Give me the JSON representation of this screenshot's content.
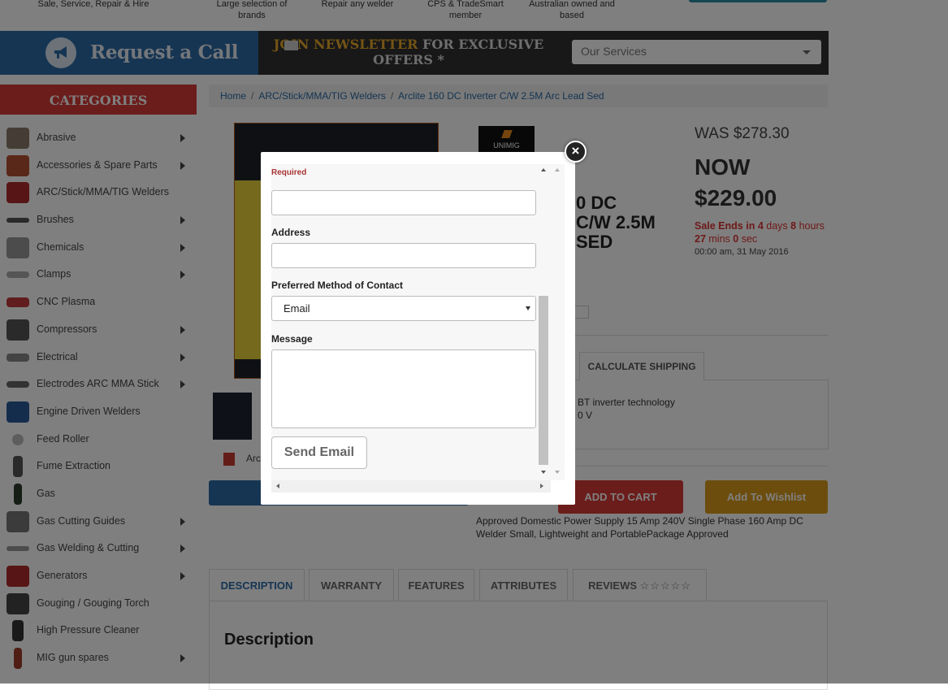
{
  "topbar": {
    "items": [
      {
        "text": "Sale, Service, Repair & Hire"
      },
      {
        "text": "Large selection of brands"
      },
      {
        "text": "Repair any welder"
      },
      {
        "text": "CPS & TradeSmart member"
      },
      {
        "text": "Australian owned and based"
      }
    ]
  },
  "header": {
    "request_call": "Request a Call",
    "newsletter_highlight": "JOIN NEWSLETTER",
    "newsletter_rest": "FOR EXCLUSIVE OFFERS *",
    "services_placeholder": "Our Services"
  },
  "sidebar": {
    "title": "CATEGORIES",
    "items": [
      {
        "label": "Abrasive",
        "has_sub": true
      },
      {
        "label": "Accessories & Spare Parts",
        "has_sub": true
      },
      {
        "label": "ARC/Stick/MMA/TIG Welders",
        "has_sub": false
      },
      {
        "label": "Brushes",
        "has_sub": true
      },
      {
        "label": "Chemicals",
        "has_sub": true
      },
      {
        "label": "Clamps",
        "has_sub": true
      },
      {
        "label": "CNC Plasma",
        "has_sub": false
      },
      {
        "label": "Compressors",
        "has_sub": true
      },
      {
        "label": "Electrical",
        "has_sub": true
      },
      {
        "label": "Electrodes ARC MMA Stick",
        "has_sub": true
      },
      {
        "label": "Engine Driven Welders",
        "has_sub": false
      },
      {
        "label": "Feed Roller",
        "has_sub": false
      },
      {
        "label": "Fume Extraction",
        "has_sub": false
      },
      {
        "label": "Gas",
        "has_sub": false
      },
      {
        "label": "Gas Cutting Guides",
        "has_sub": true
      },
      {
        "label": "Gas Welding & Cutting",
        "has_sub": true
      },
      {
        "label": "Generators",
        "has_sub": true
      },
      {
        "label": "Gouging / Gouging Torch",
        "has_sub": false
      },
      {
        "label": "High Pressure Cleaner",
        "has_sub": false
      },
      {
        "label": "MIG gun spares",
        "has_sub": true
      }
    ]
  },
  "breadcrumb": {
    "home": "Home",
    "category": "ARC/Stick/MMA/TIG Welders",
    "current": "Arclite 160 DC Inverter C/W 2.5M Arc Lead Sed"
  },
  "product": {
    "brand_logo": "UNIMIG",
    "title_line1": "0 DC",
    "title_line2": "C/W 2.5M",
    "title_line3": "SED",
    "was_price": "WAS $278.30",
    "now_label": "NOW",
    "now_price": "$229.00",
    "sale_prefix": "Sale Ends in",
    "sale_days_n": "4",
    "sale_days": "days",
    "sale_hours_n": "8",
    "sale_hours": "hours",
    "sale_mins_n": "27",
    "sale_mins": "mins",
    "sale_secs_n": "0",
    "sale_secs": "sec",
    "sale_end_date": "00:00 am, 31 May 2016",
    "pdf_label": "Arc",
    "shipping_tab": "CALCULATE SHIPPING",
    "feature_line1": "BT inverter technology",
    "feature_line2": "0 V",
    "add_to_cart": "ADD TO CART",
    "add_to_wishlist": "Add To Wishlist",
    "approved_text": "Approved Domestic Power Supply 15 Amp 240V Single Phase 160 Amp DC Welder Small, Lightweight and PortablePackage Approved"
  },
  "tabs": {
    "description": "DESCRIPTION",
    "warranty": "WARRANTY",
    "features": "FEATURES",
    "attributes": "ATTRIBUTES",
    "reviews": "REVIEWS",
    "reviews_stars": "☆☆☆☆☆",
    "description_heading": "Description"
  },
  "modal": {
    "required_label": "Required",
    "address_label": "Address",
    "contact_method_label": "Preferred Method of Contact",
    "contact_method_value": "Email",
    "message_label": "Message",
    "send_button": "Send Email",
    "close_symbol": "×"
  },
  "colors": {
    "brand_blue": "#2d6aa6",
    "brand_red": "#d63a36",
    "wishlist_gold": "#d99a1a",
    "newsletter_gold": "#e8a92a"
  }
}
